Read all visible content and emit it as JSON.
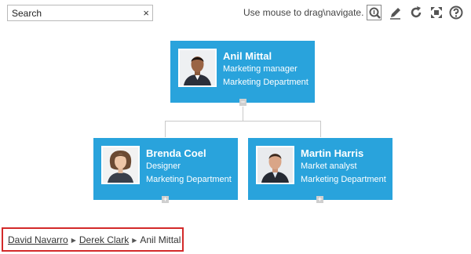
{
  "search": {
    "value": "Search",
    "clear_glyph": "×"
  },
  "toolbar": {
    "hint": "Use mouse to drag\\navigate.",
    "tools": [
      "zoom-icon",
      "pencil-icon",
      "refresh-icon",
      "fit-screen-icon",
      "help-icon"
    ]
  },
  "nodes": {
    "root": {
      "name": "Anil Mittal",
      "title": "Marketing manager",
      "department": "Marketing Department",
      "toggle": "−"
    },
    "child1": {
      "name": "Brenda Coel",
      "title": "Designer",
      "department": "Marketing Department",
      "toggle": "+"
    },
    "child2": {
      "name": "Martin Harris",
      "title": "Market analyst",
      "department": "Marketing Department",
      "toggle": "+"
    }
  },
  "breadcrumb": {
    "items": [
      "David Navarro",
      "Derek Clark",
      "Anil Mittal"
    ],
    "separator": "▶"
  },
  "colors": {
    "card": "#29a3dc",
    "breadcrumb_border": "#d32a2a",
    "connector": "#c9c9c9"
  }
}
